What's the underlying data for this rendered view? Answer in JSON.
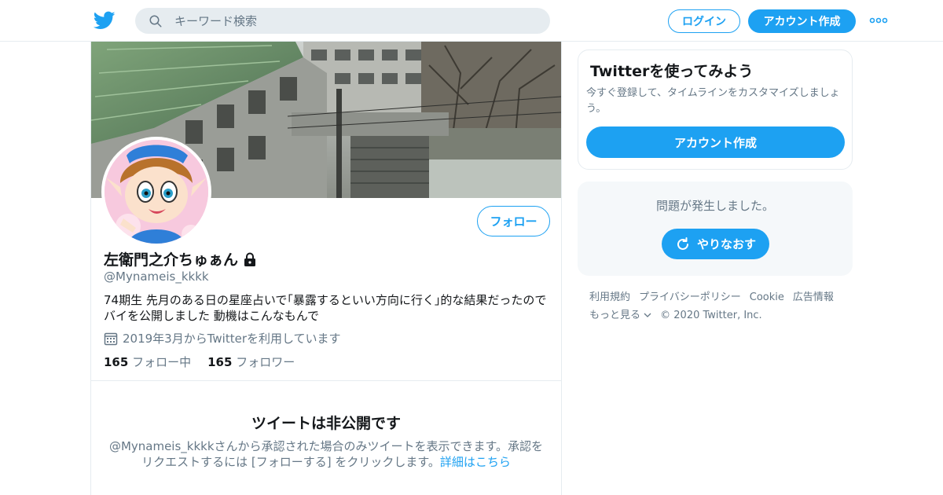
{
  "header": {
    "search_placeholder": "キーワード検索",
    "login_label": "ログイン",
    "signup_label": "アカウント作成"
  },
  "profile": {
    "name": "左衛門之介ちゅぁん",
    "handle": "@Mynameis_kkkk",
    "bio": "74期生 先月のある日の星座占いで｢暴露するといい方向に行く｣的な結果だったのでバイを公開しました 動機はこんなもんで",
    "joined": "2019年3月からTwitterを利用しています",
    "following_count": "165",
    "following_label": "フォロー中",
    "followers_count": "165",
    "followers_label": "フォロワー",
    "follow_button": "フォロー"
  },
  "protected": {
    "title": "ツイートは非公開です",
    "text": "@Mynameis_kkkkさんから承認された場合のみツイートを表示できます。承認をリクエストするには [フォローする] をクリックします。",
    "link": "詳細はこちら"
  },
  "sidebar": {
    "signup_card": {
      "title": "Twitterを使ってみよう",
      "subtitle": "今すぐ登録して、タイムラインをカスタマイズしましょう。",
      "button": "アカウント作成"
    },
    "error_card": {
      "message": "問題が発生しました。",
      "retry": "やりなおす"
    },
    "footer": {
      "links_row1": [
        "利用規約",
        "プライバシーポリシー",
        "Cookie",
        "広告情報"
      ],
      "more": "もっと見る",
      "copyright": "© 2020 Twitter, Inc."
    }
  },
  "colors": {
    "accent": "#1da1f2",
    "muted": "#657786",
    "border": "#e6ecf0"
  },
  "icons": [
    "twitter-bird-icon",
    "search-icon",
    "more-dots-icon",
    "lock-icon",
    "calendar-icon",
    "refresh-icon",
    "chevron-down-icon"
  ]
}
